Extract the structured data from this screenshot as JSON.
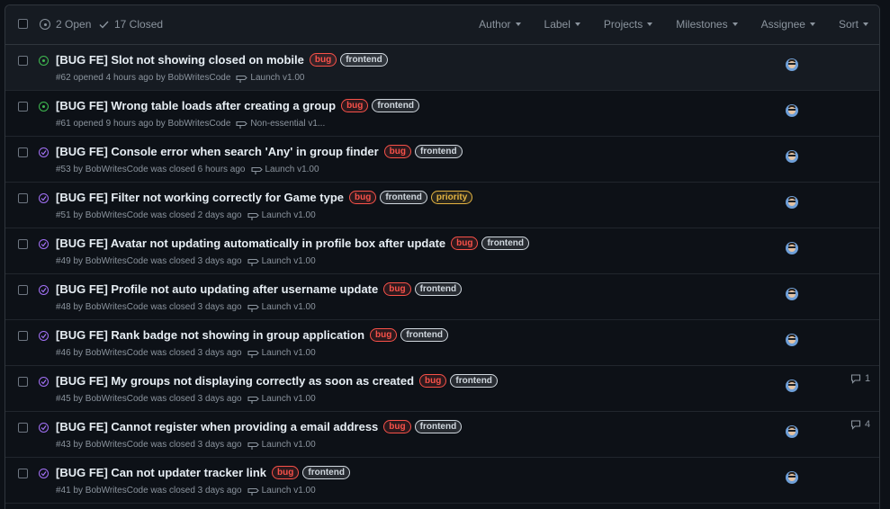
{
  "header": {
    "open_label": "2 Open",
    "closed_label": "17 Closed",
    "filters": [
      "Author",
      "Label",
      "Projects",
      "Milestones",
      "Assignee",
      "Sort"
    ]
  },
  "colors": {
    "open": "#3fb950",
    "closed": "#a371f7",
    "bug": "#f85149",
    "frontend": "#d0d7de",
    "priority": "#e3b341"
  },
  "issues": [
    {
      "state": "open",
      "title": "[BUG FE] Slot not showing closed on mobile",
      "labels": [
        "bug",
        "frontend"
      ],
      "meta": "#62 opened 4 hours ago by BobWritesCode",
      "milestone": "Launch v1.00",
      "comments": ""
    },
    {
      "state": "open",
      "title": "[BUG FE] Wrong table loads after creating a group",
      "labels": [
        "bug",
        "frontend"
      ],
      "meta": "#61 opened 9 hours ago by BobWritesCode",
      "milestone": "Non-essential v1...",
      "comments": ""
    },
    {
      "state": "closed",
      "title": "[BUG FE] Console error when search 'Any' in group finder",
      "labels": [
        "bug",
        "frontend"
      ],
      "meta": "#53 by BobWritesCode was closed 6 hours ago",
      "milestone": "Launch v1.00",
      "comments": ""
    },
    {
      "state": "closed",
      "title": "[BUG FE] Filter not working correctly for Game type",
      "labels": [
        "bug",
        "frontend",
        "priority"
      ],
      "meta": "#51 by BobWritesCode was closed 2 days ago",
      "milestone": "Launch v1.00",
      "comments": ""
    },
    {
      "state": "closed",
      "title": "[BUG FE] Avatar not updating automatically in profile box after update",
      "labels": [
        "bug",
        "frontend"
      ],
      "meta": "#49 by BobWritesCode was closed 3 days ago",
      "milestone": "Launch v1.00",
      "comments": ""
    },
    {
      "state": "closed",
      "title": "[BUG FE] Profile not auto updating after username update",
      "labels": [
        "bug",
        "frontend"
      ],
      "meta": "#48 by BobWritesCode was closed 3 days ago",
      "milestone": "Launch v1.00",
      "comments": ""
    },
    {
      "state": "closed",
      "title": "[BUG FE] Rank badge not showing in group application",
      "labels": [
        "bug",
        "frontend"
      ],
      "meta": "#46 by BobWritesCode was closed 3 days ago",
      "milestone": "Launch v1.00",
      "comments": ""
    },
    {
      "state": "closed",
      "title": "[BUG FE] My groups not displaying correctly as soon as created",
      "labels": [
        "bug",
        "frontend"
      ],
      "meta": "#45 by BobWritesCode was closed 3 days ago",
      "milestone": "Launch v1.00",
      "comments": "1"
    },
    {
      "state": "closed",
      "title": "[BUG FE] Cannot register when providing a email address",
      "labels": [
        "bug",
        "frontend"
      ],
      "meta": "#43 by BobWritesCode was closed 3 days ago",
      "milestone": "Launch v1.00",
      "comments": "4"
    },
    {
      "state": "closed",
      "title": "[BUG FE] Can not updater tracker link",
      "labels": [
        "bug",
        "frontend"
      ],
      "meta": "#41 by BobWritesCode was closed 3 days ago",
      "milestone": "Launch v1.00",
      "comments": ""
    }
  ]
}
